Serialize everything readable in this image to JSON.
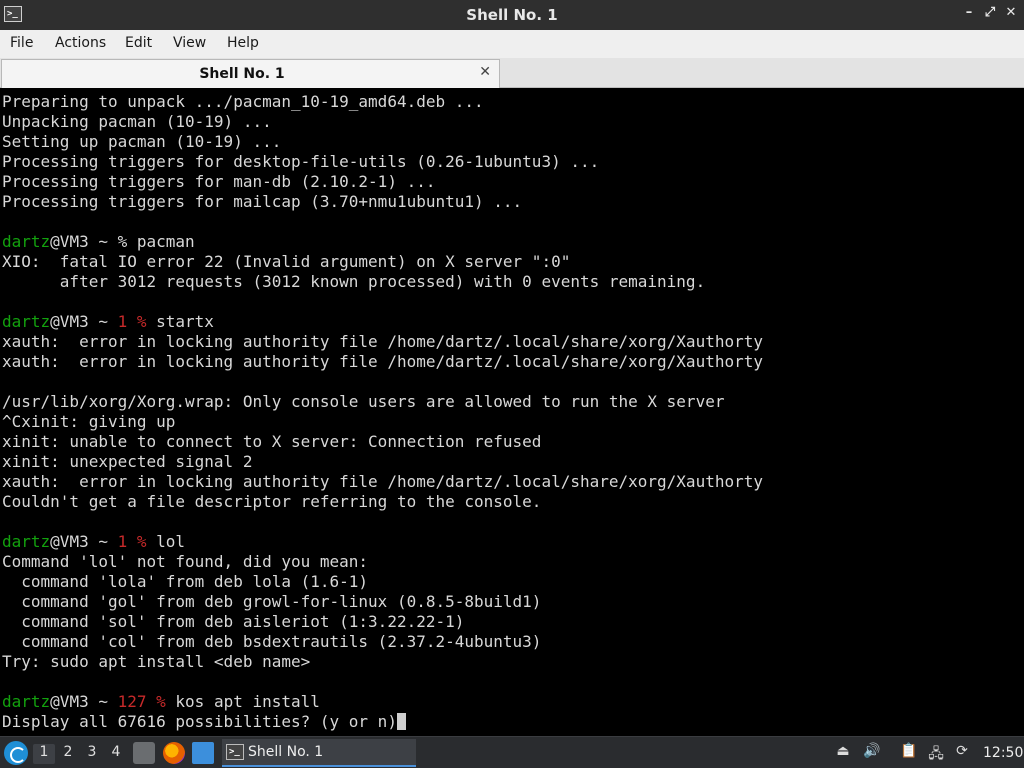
{
  "window": {
    "title": "Shell No. 1",
    "app_icon": ">_",
    "minimize": "–",
    "maximize": "⤢",
    "close": "✕"
  },
  "menu": [
    "File",
    "Actions",
    "Edit",
    "View",
    "Help"
  ],
  "tab": {
    "label": "Shell No. 1",
    "close": "✕"
  },
  "terminal": {
    "colors": {
      "background": "#000000",
      "text": "#d8d8d8",
      "user": "#13a10e",
      "error_code": "#c72a2a"
    },
    "lines": [
      {
        "type": "text",
        "text": "Preparing to unpack .../pacman_10-19_amd64.deb ..."
      },
      {
        "type": "text",
        "text": "Unpacking pacman (10-19) ..."
      },
      {
        "type": "text",
        "text": "Setting up pacman (10-19) ..."
      },
      {
        "type": "text",
        "text": "Processing triggers for desktop-file-utils (0.26-1ubuntu3) ..."
      },
      {
        "type": "text",
        "text": "Processing triggers for man-db (2.10.2-1) ..."
      },
      {
        "type": "text",
        "text": "Processing triggers for mailcap (3.70+nmu1ubuntu1) ..."
      },
      {
        "type": "text",
        "text": ""
      },
      {
        "type": "prompt",
        "user": "dartz",
        "host": "@VM3 ~ ",
        "code": "",
        "sym": "% ",
        "cmd": "pacman"
      },
      {
        "type": "text",
        "text": "XIO:  fatal IO error 22 (Invalid argument) on X server \":0\""
      },
      {
        "type": "text",
        "text": "      after 3012 requests (3012 known processed) with 0 events remaining."
      },
      {
        "type": "text",
        "text": ""
      },
      {
        "type": "prompt",
        "user": "dartz",
        "host": "@VM3 ~ ",
        "code": "1 % ",
        "sym": "",
        "cmd": "startx"
      },
      {
        "type": "text",
        "text": "xauth:  error in locking authority file /home/dartz/.local/share/xorg/Xauthorty"
      },
      {
        "type": "text",
        "text": "xauth:  error in locking authority file /home/dartz/.local/share/xorg/Xauthorty"
      },
      {
        "type": "text",
        "text": ""
      },
      {
        "type": "text",
        "text": "/usr/lib/xorg/Xorg.wrap: Only console users are allowed to run the X server"
      },
      {
        "type": "text",
        "text": "^Cxinit: giving up"
      },
      {
        "type": "text",
        "text": "xinit: unable to connect to X server: Connection refused"
      },
      {
        "type": "text",
        "text": "xinit: unexpected signal 2"
      },
      {
        "type": "text",
        "text": "xauth:  error in locking authority file /home/dartz/.local/share/xorg/Xauthorty"
      },
      {
        "type": "text",
        "text": "Couldn't get a file descriptor referring to the console."
      },
      {
        "type": "text",
        "text": ""
      },
      {
        "type": "prompt",
        "user": "dartz",
        "host": "@VM3 ~ ",
        "code": "1 % ",
        "sym": "",
        "cmd": "lol"
      },
      {
        "type": "text",
        "text": "Command 'lol' not found, did you mean:"
      },
      {
        "type": "text",
        "text": "  command 'lola' from deb lola (1.6-1)"
      },
      {
        "type": "text",
        "text": "  command 'gol' from deb growl-for-linux (0.8.5-8build1)"
      },
      {
        "type": "text",
        "text": "  command 'sol' from deb aisleriot (1:3.22.22-1)"
      },
      {
        "type": "text",
        "text": "  command 'col' from deb bsdextrautils (2.37.2-4ubuntu3)"
      },
      {
        "type": "text",
        "text": "Try: sudo apt install <deb name>"
      },
      {
        "type": "text",
        "text": ""
      },
      {
        "type": "prompt",
        "user": "dartz",
        "host": "@VM3 ~ ",
        "code": "127 % ",
        "sym": "",
        "cmd": "kos apt install"
      },
      {
        "type": "input",
        "text": "Display all 67616 possibilities? (y or n)"
      }
    ]
  },
  "taskbar": {
    "workspaces": [
      "1",
      "2",
      "3",
      "4"
    ],
    "active_workspace": "1",
    "task": {
      "label": "Shell No. 1",
      "icon": ">_"
    },
    "tray": {
      "eject": "⏏",
      "volume": "🔊",
      "clipboard": "📋",
      "network": "🖧",
      "updates": "⟳"
    },
    "clock": "12:50"
  }
}
